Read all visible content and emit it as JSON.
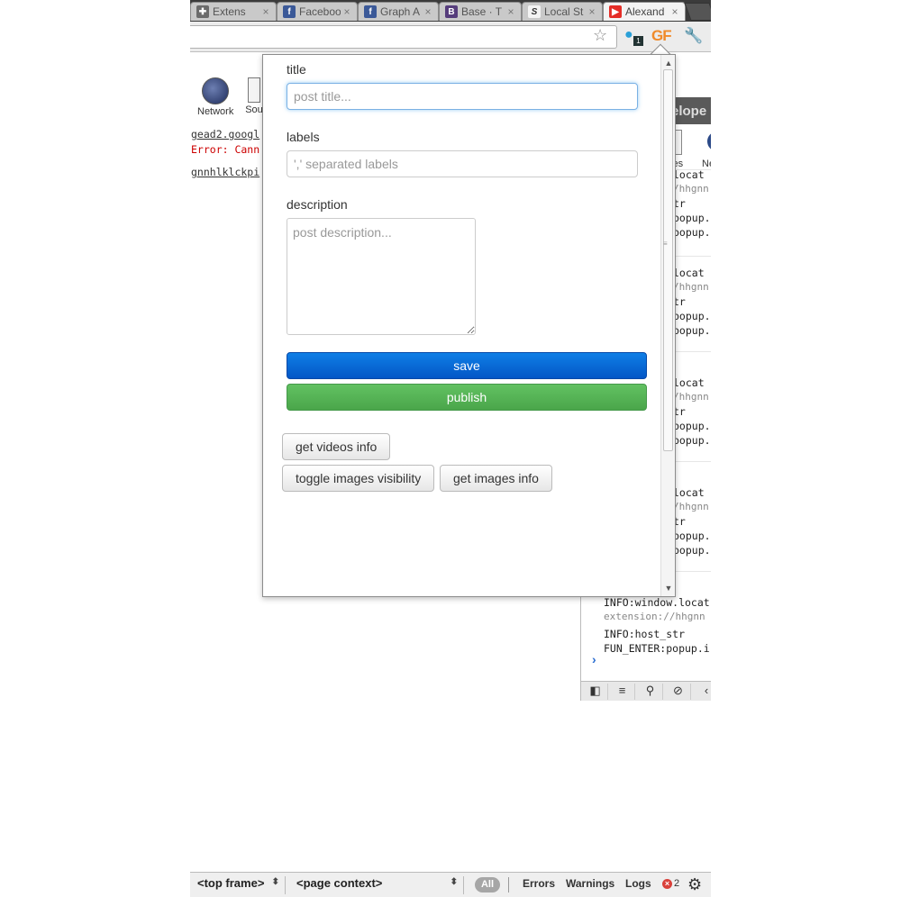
{
  "tabs": [
    {
      "title": "Extens",
      "icon": "puzzle-icon",
      "color": "#6b6b6b"
    },
    {
      "title": "Faceboo",
      "icon": "facebook-icon",
      "color": "#3b5998"
    },
    {
      "title": "Graph A",
      "icon": "facebook-icon",
      "color": "#3b5998"
    },
    {
      "title": "Base · T",
      "icon": "bootstrap-icon",
      "color": "#563d7c"
    },
    {
      "title": "Local St",
      "icon": "s-logo-icon",
      "color": "#444444"
    },
    {
      "title": "Alexand",
      "icon": "youtube-icon",
      "color": "#e52d27"
    }
  ],
  "tab_close_glyph": "×",
  "extensions": {
    "badge_count": "1",
    "gf_label": "GF"
  },
  "devtools": {
    "tools": [
      "Network",
      "Sou"
    ],
    "console_lines": [
      "gead2.googl",
      "Error: Cann",
      "gnnhlklckpi"
    ],
    "panel_title": "elope",
    "right_tools": [
      "ces",
      "Ne"
    ],
    "log_groups": [
      {
        "lines": [
          "locat",
          "/hhgnn",
          "tr",
          "popup.i",
          "popup.m"
        ]
      },
      {
        "lines": [
          "locat",
          "/hhgnn",
          "tr",
          "popup.i",
          "popup.m"
        ]
      },
      {
        "lines": [
          "locat",
          "/hhgnn",
          "tr",
          "popup.i",
          "popup.m"
        ]
      },
      {
        "lines": [
          "locat",
          "/hhgnn",
          "tr",
          "popup.i",
          "popup.m"
        ]
      }
    ],
    "full_log": [
      "INFO:window.locat",
      "extension://hhgnn",
      "INFO:host_str",
      "FUN_ENTER:popup.i"
    ],
    "prompt": "›"
  },
  "bottom_bar": {
    "frame_select": "<top frame>",
    "context_select": "<page context>",
    "filters": [
      "All",
      "Errors",
      "Warnings",
      "Logs"
    ],
    "error_count": "2"
  },
  "popup": {
    "title_label": "title",
    "title_placeholder": "post title...",
    "labels_label": "labels",
    "labels_placeholder": "',' separated labels",
    "description_label": "description",
    "description_placeholder": "post description...",
    "save_button": "save",
    "publish_button": "publish",
    "get_videos_button": "get videos info",
    "toggle_images_button": "toggle images visibility",
    "get_images_button": "get images info"
  },
  "colors": {
    "save": "#0b6fdc",
    "publish": "#57b657",
    "error_red": "#cc0000"
  }
}
